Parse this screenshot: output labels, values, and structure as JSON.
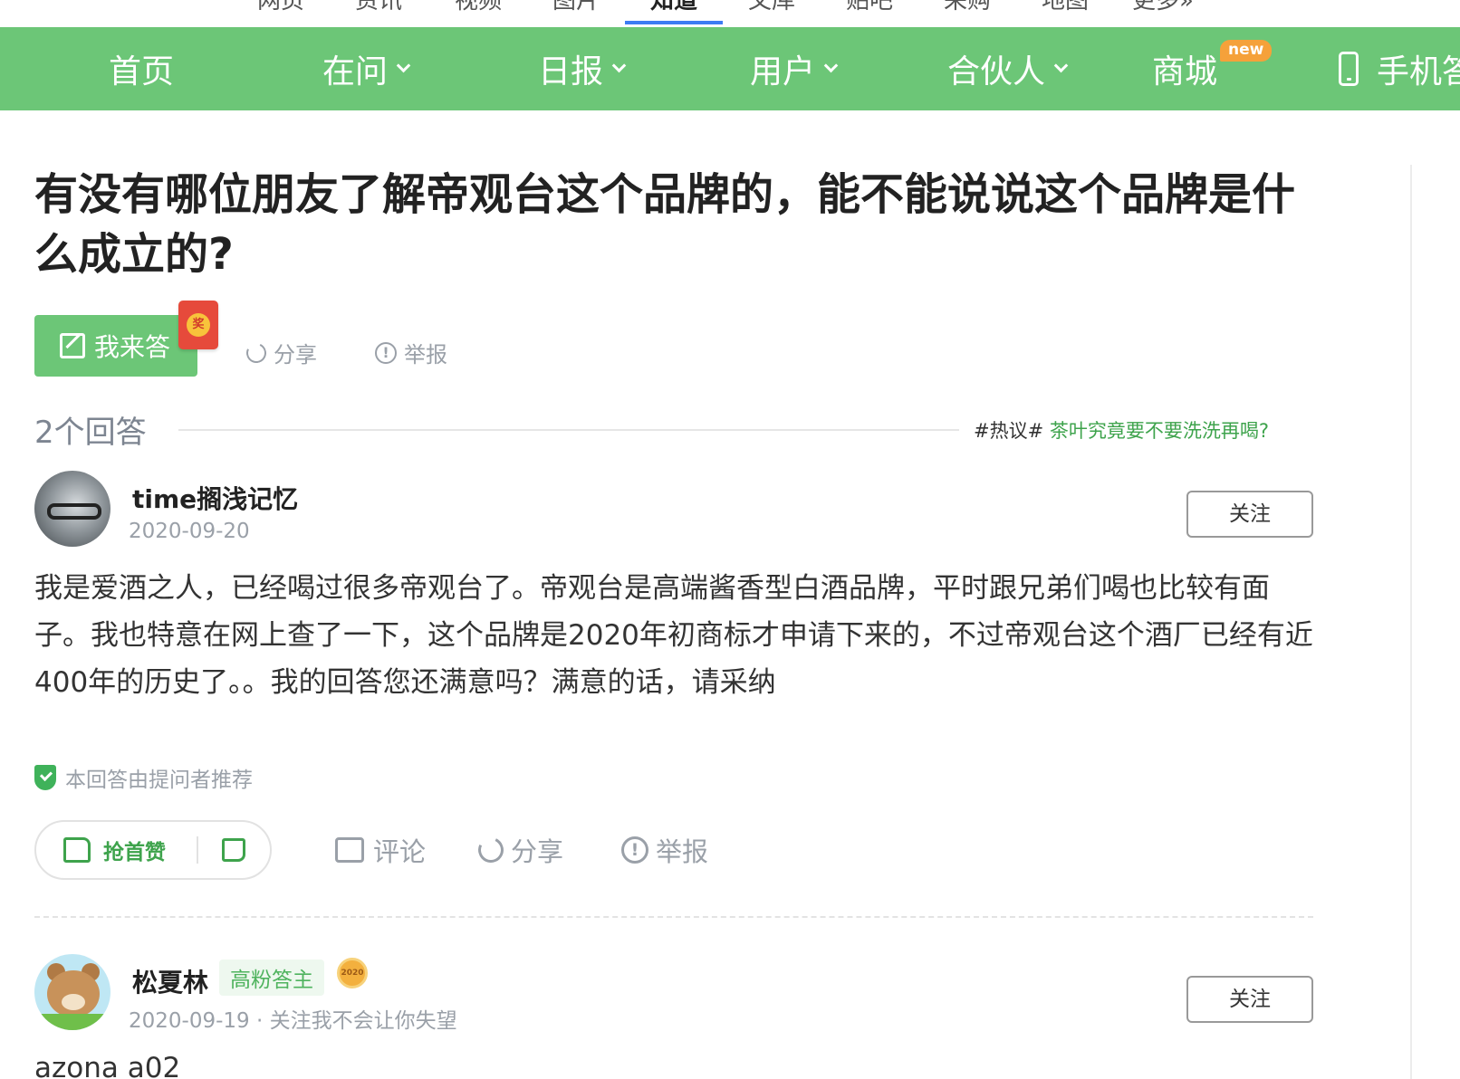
{
  "top_tabs": [
    {
      "label": "网页",
      "active": false
    },
    {
      "label": "资讯",
      "active": false
    },
    {
      "label": "视频",
      "active": false
    },
    {
      "label": "图片",
      "active": false
    },
    {
      "label": "知道",
      "active": true
    },
    {
      "label": "文库",
      "active": false
    },
    {
      "label": "贴吧",
      "active": false
    },
    {
      "label": "采购",
      "active": false
    },
    {
      "label": "地图",
      "active": false
    },
    {
      "label": "更多»",
      "active": false
    }
  ],
  "nav": {
    "items": [
      {
        "label": "首页",
        "has_dropdown": false
      },
      {
        "label": "在问",
        "has_dropdown": true
      },
      {
        "label": "日报",
        "has_dropdown": true
      },
      {
        "label": "用户",
        "has_dropdown": true
      },
      {
        "label": "合伙人",
        "has_dropdown": true
      },
      {
        "label": "商城",
        "has_dropdown": false
      },
      {
        "label": "手机答题",
        "has_dropdown": false
      }
    ],
    "new_badge": "new",
    "background_color": "#6cc677"
  },
  "question": {
    "title": "有没有哪位朋友了解帝观台这个品牌的，能不能说说这个品牌是什么成立的?",
    "answer_button": "我来答",
    "redpacket_label": "奖",
    "share_label": "分享",
    "report_label": "举报"
  },
  "answers_header": {
    "count_label": "2个回答",
    "hot_prefix": "#热议#",
    "hot_link": "茶叶究竟要不要洗洗再喝?"
  },
  "answers": [
    {
      "user": "time搁浅记忆",
      "date": "2020-09-20",
      "follow_label": "关注",
      "text": "我是爱酒之人，已经喝过很多帝观台了。帝观台是高端酱香型白酒品牌，平时跟兄弟们喝也比较有面子。我也特意在网上查了一下，这个品牌是2020年初商标才申请下来的，不过帝观台这个酒厂已经有近400年的历史了。。我的回答您还满意吗？满意的话，请采纳",
      "recommended_label": "本回答由提问者推荐",
      "like_label": "抢首赞",
      "comment_label": "评论",
      "share_label": "分享",
      "report_label": "举报"
    },
    {
      "user": "松夏林",
      "badge": "高粉答主",
      "medal_label": "2020",
      "date_line": "2020-09-19 · 关注我不会让你失望",
      "follow_label": "关注",
      "text": "azona a02"
    }
  ],
  "colors": {
    "brand_green": "#6cc677",
    "link_green": "#3ea34c",
    "tab_underline": "#3d7cf3",
    "new_badge": "#f5a13a"
  }
}
